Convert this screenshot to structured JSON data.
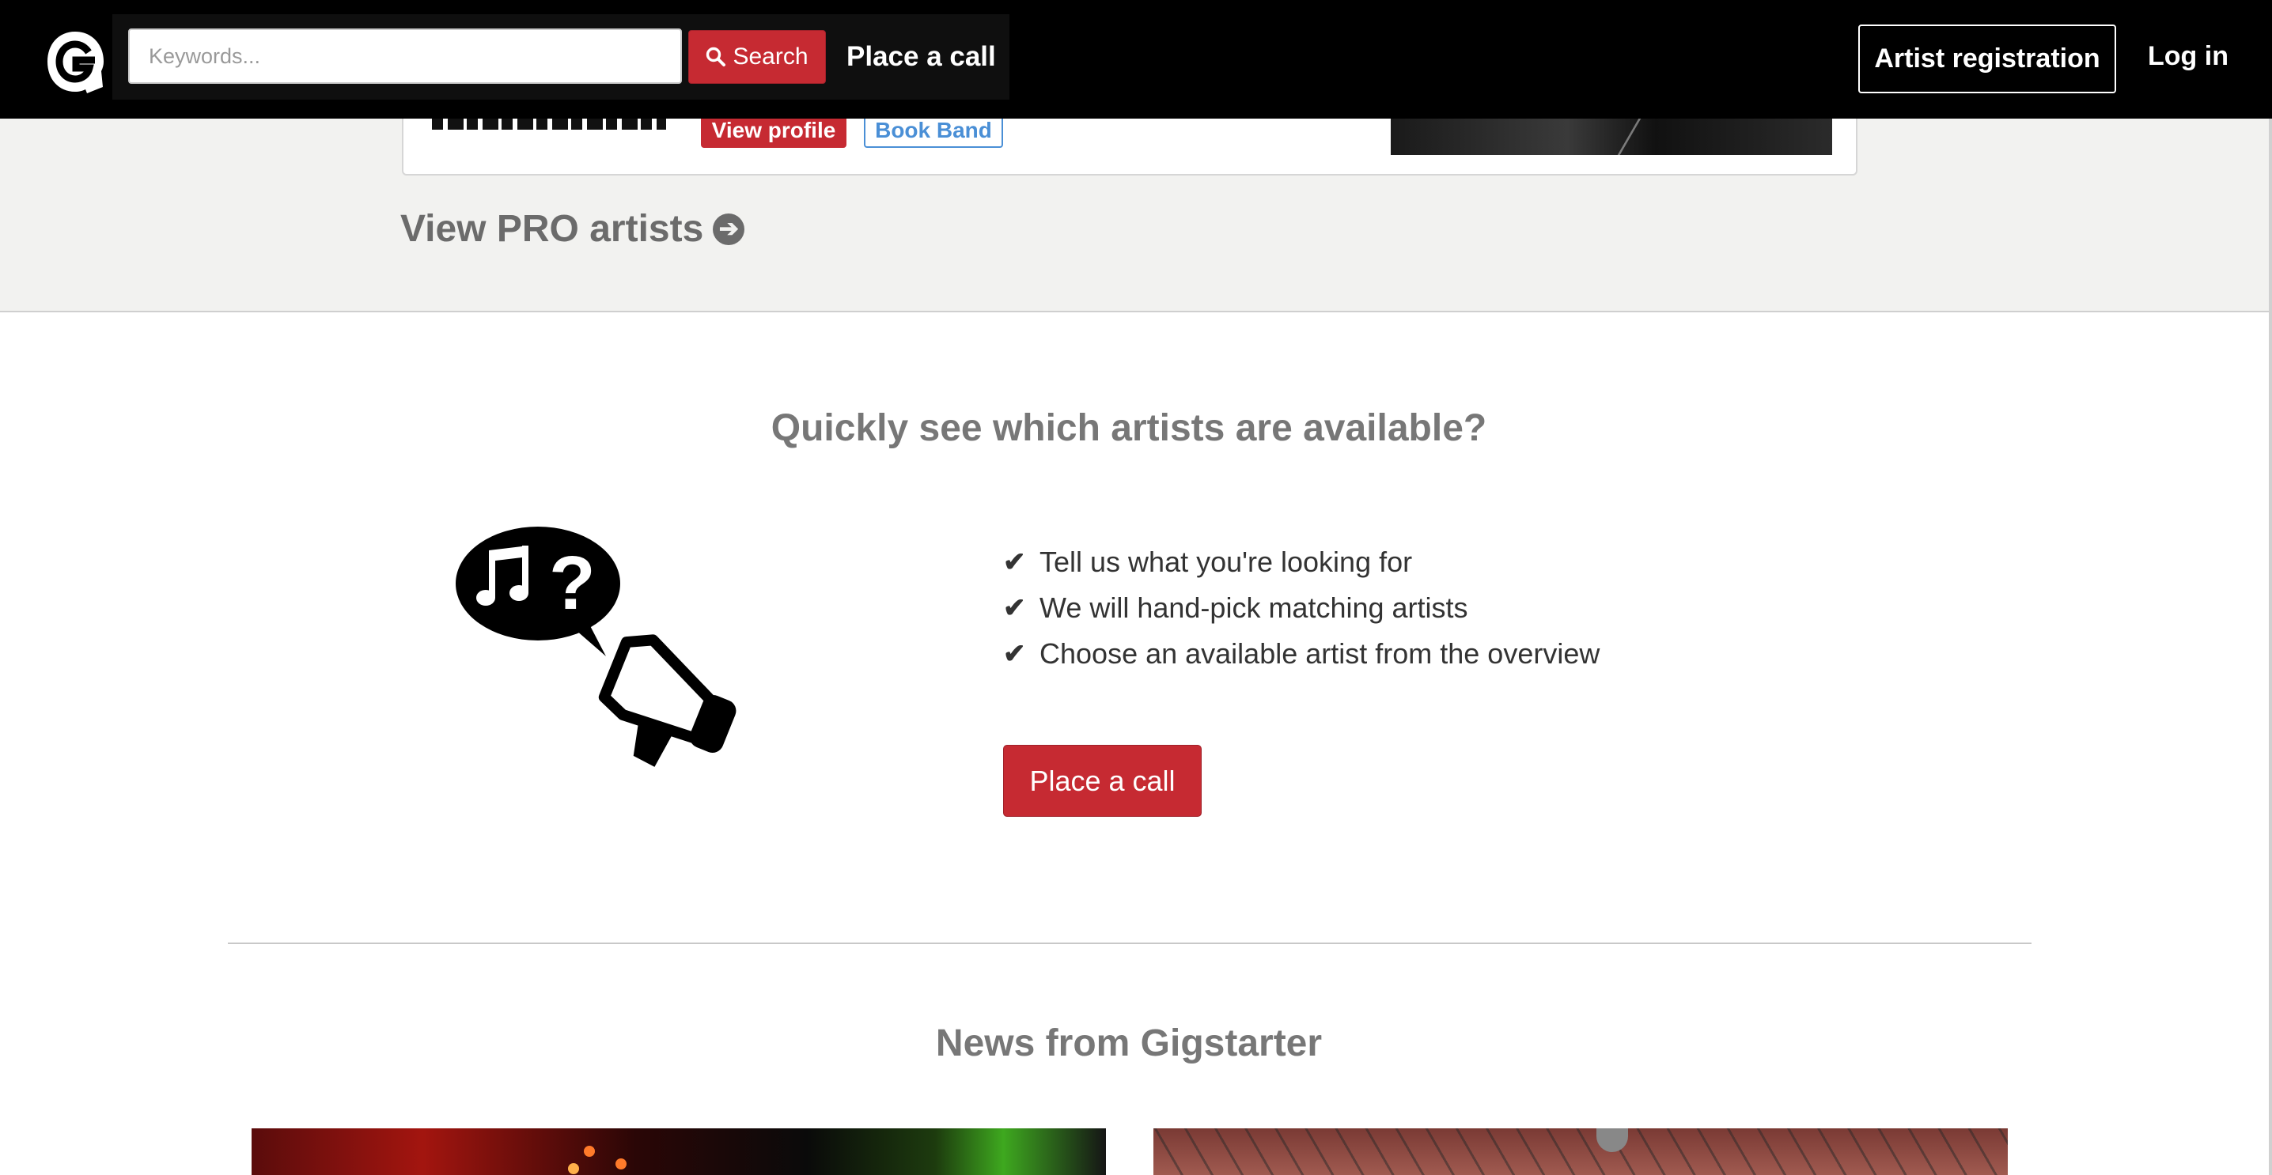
{
  "header": {
    "search_placeholder": "Keywords...",
    "search_button_label": "Search",
    "place_call_link": "Place a call",
    "artist_registration_label": "Artist registration",
    "login_label": "Log in"
  },
  "pro_card": {
    "view_profile_label": "View profile",
    "book_band_label": "Book Band"
  },
  "view_pro_link": "View PRO artists",
  "call_section": {
    "title": "Quickly see which artists are available?",
    "bullets": [
      "Tell us what you're looking for",
      "We will hand-pick matching artists",
      "Choose an available artist from the overview"
    ],
    "cta_label": "Place a call"
  },
  "news": {
    "title": "News from Gigstarter"
  },
  "colors": {
    "brand_red": "#c62a32",
    "nav_bg": "#000000",
    "band_bg": "#f2f2f0",
    "link_blue": "#4a8fd6"
  },
  "icons": {
    "logo": "gigstarter-g-logo",
    "search": "search-icon",
    "view_pro": "circle-arrow-right-icon",
    "check": "check-icon",
    "megaphone": "megaphone-icon"
  }
}
